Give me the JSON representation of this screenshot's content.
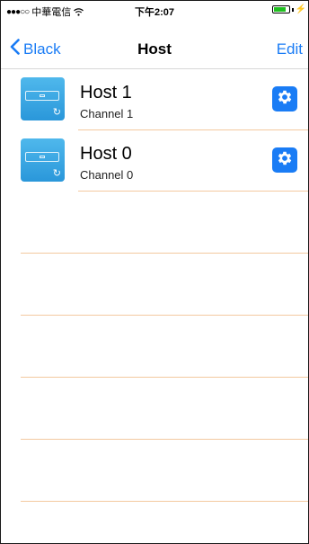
{
  "status_bar": {
    "signal": "●●●○○",
    "carrier": "中華電信",
    "time": "下午2:07",
    "battery_level": 0.8,
    "battery_color": "#20c020"
  },
  "nav": {
    "back_label": "Black",
    "title": "Host",
    "edit_label": "Edit",
    "accent_color": "#1a7cf5"
  },
  "hosts": [
    {
      "name": "Host 1",
      "channel": "Channel 1",
      "icon": "host-device-icon",
      "action_icon": "gear-icon"
    },
    {
      "name": "Host 0",
      "channel": "Channel 0",
      "icon": "host-device-icon",
      "action_icon": "gear-icon"
    }
  ],
  "separator_color": "#f3c9a0"
}
